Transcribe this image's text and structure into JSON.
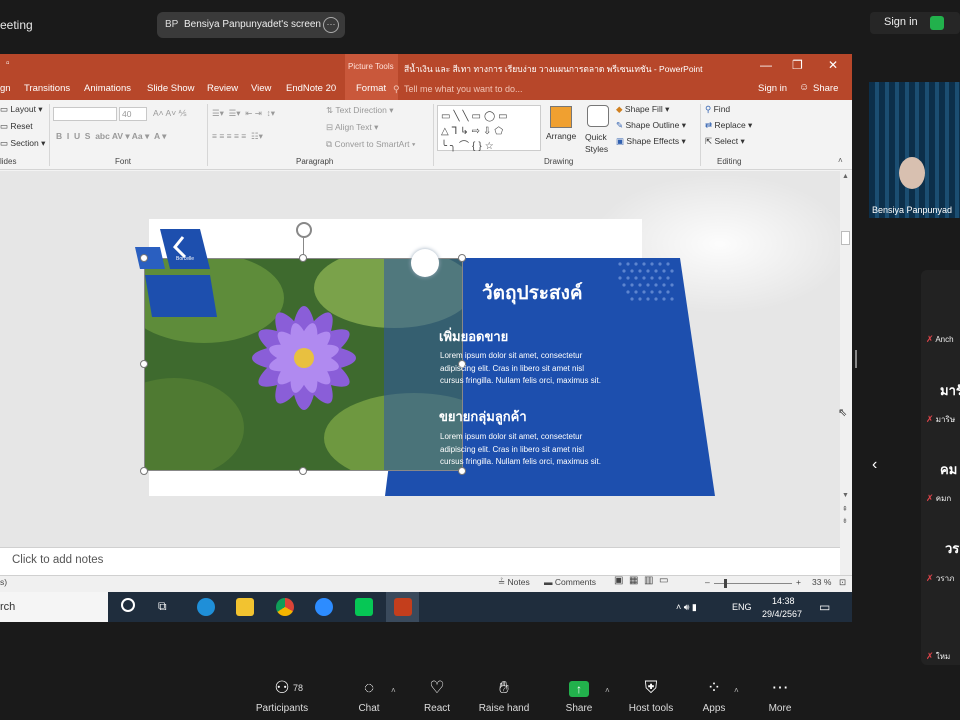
{
  "zoom": {
    "meeting_title": "eeting",
    "share_initials": "BP",
    "share_label": "Bensiya Panpunyadet's screen",
    "signin_label": "Sign in",
    "participants_count": "78",
    "toolbar": [
      {
        "label": "Participants",
        "icon": "participants-icon"
      },
      {
        "label": "Chat",
        "icon": "chat-icon"
      },
      {
        "label": "React",
        "icon": "heart-icon"
      },
      {
        "label": "Raise hand",
        "icon": "hand-icon"
      },
      {
        "label": "Share",
        "icon": "share-icon",
        "color": "#22b14c"
      },
      {
        "label": "Host tools",
        "icon": "shield-icon"
      },
      {
        "label": "Apps",
        "icon": "apps-icon"
      },
      {
        "label": "More",
        "icon": "more-icon"
      }
    ],
    "video_name": "Bensiya Panpunyad",
    "side_items": [
      "Anch",
      "มารั",
      "มาริษ",
      "คม",
      "คมก",
      "วร",
      "วราภ",
      "ใหม"
    ]
  },
  "ppt": {
    "picture_tools": "Picture Tools",
    "title": "สีน้ำเงิน และ สีเทา ทางการ เรียบง่าย วางแผนการตลาด พรีเซนเทชัน - PowerPoint",
    "tabs": [
      "gn",
      "Transitions",
      "Animations",
      "Slide Show",
      "Review",
      "View",
      "EndNote 20",
      "Format"
    ],
    "tell_me": "Tell me what you want to do...",
    "signin": "Sign in",
    "share": "Share",
    "ribbon": {
      "layout": "Layout",
      "reset": "Reset",
      "section": "Section",
      "slides_group": "lides",
      "font_size": "40",
      "font_group": "Font",
      "text_direction": "Text Direction",
      "align_text": "Align Text",
      "convert_smartart": "Convert to SmartArt",
      "paragraph_group": "Paragraph",
      "arrange": "Arrange",
      "quick_styles": "Quick Styles",
      "shape_fill": "Shape Fill",
      "shape_outline": "Shape Outline",
      "shape_effects": "Shape Effects",
      "drawing_group": "Drawing",
      "find": "Find",
      "replace": "Replace",
      "select": "Select",
      "editing_group": "Editing"
    },
    "slide": {
      "logo_text": "Borcelle",
      "heading": "วัตถุประสงค์",
      "sub1": "เพิ่มยอดขาย",
      "body1": [
        "Lorem ipsum dolor sit amet, consectetur",
        "adipiscing elit. Cras in libero sit amet nisl",
        "cursus fringilla. Nullam felis orci, maximus sit."
      ],
      "sub2": "ขยายกลุ่มลูกค้า",
      "body2": [
        "Lorem ipsum dolor sit amet, consectetur",
        "adipiscing elit. Cras in libero sit amet nisl",
        "cursus fringilla. Nullam felis orci, maximus sit."
      ]
    },
    "notes_placeholder": "Click to add notes",
    "status": {
      "left": "s)",
      "notes": "Notes",
      "comments": "Comments",
      "zoom": "33 %"
    },
    "taskbar": {
      "search": "rch",
      "lang": "ENG",
      "time": "14:38",
      "date": "29/4/2567"
    }
  },
  "colors": {
    "ppt_red": "#b7472a",
    "slide_blue": "#1d4fae",
    "zoom_green": "#22b14c"
  }
}
